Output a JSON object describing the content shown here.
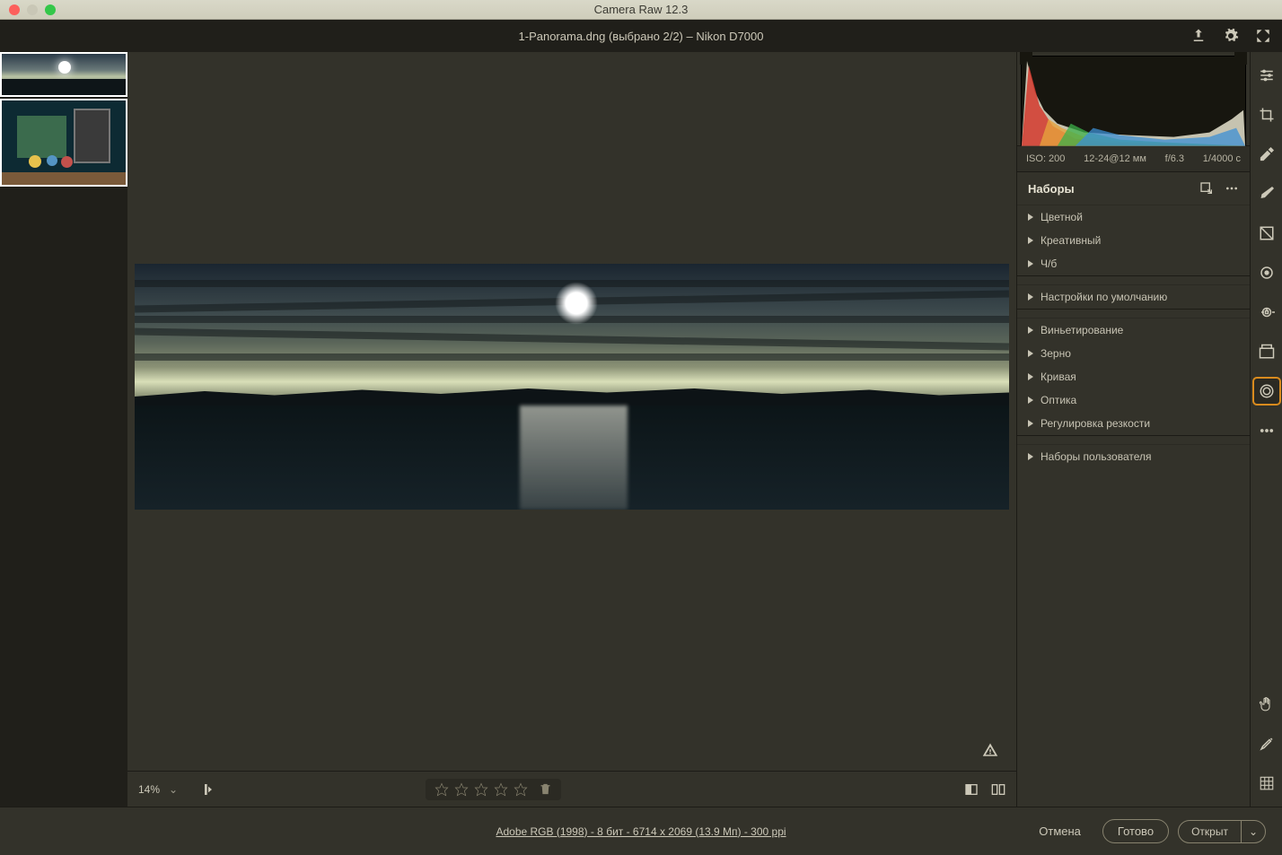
{
  "titlebar": {
    "app_title": "Camera Raw 12.3"
  },
  "header": {
    "file_title": "1-Panorama.dng (выбрано 2/2)  –  Nikon D7000"
  },
  "metadata": {
    "iso": "ISO: 200",
    "lens": "12-24@12 мм",
    "aperture": "f/6.3",
    "shutter": "1/4000 c"
  },
  "panel": {
    "title": "Наборы",
    "groups1": [
      {
        "label": "Цветной"
      },
      {
        "label": "Креативный"
      },
      {
        "label": "Ч/б"
      }
    ],
    "groups2": [
      {
        "label": "Настройки по умолчанию"
      }
    ],
    "groups3": [
      {
        "label": "Виньетирование"
      },
      {
        "label": "Зерно"
      },
      {
        "label": "Кривая"
      },
      {
        "label": "Оптика"
      },
      {
        "label": "Регулировка резкости"
      }
    ],
    "groups4": [
      {
        "label": "Наборы пользователя"
      }
    ]
  },
  "canvas_footer": {
    "zoom": "14%"
  },
  "bottom": {
    "profile": "Adobe RGB (1998) - 8 бит - 6714 x 2069 (13.9 Мп) - 300 ppi",
    "cancel": "Отмена",
    "done": "Готово",
    "open": "Открыт"
  }
}
